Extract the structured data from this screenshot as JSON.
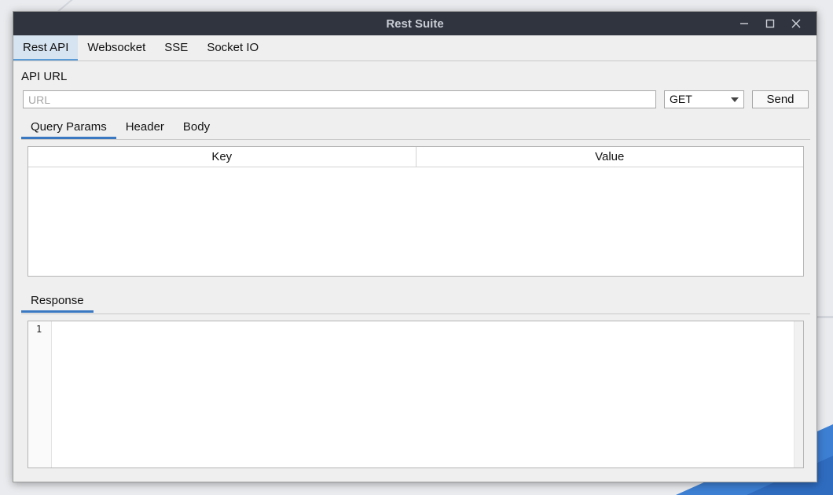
{
  "window": {
    "title": "Rest Suite"
  },
  "top_tabs": [
    {
      "label": "Rest API",
      "active": true
    },
    {
      "label": "Websocket",
      "active": false
    },
    {
      "label": "SSE",
      "active": false
    },
    {
      "label": "Socket IO",
      "active": false
    }
  ],
  "request": {
    "api_url_label": "API URL",
    "url_value": "",
    "url_placeholder": "URL",
    "method": "GET",
    "send_label": "Send"
  },
  "sub_tabs": [
    {
      "label": "Query Params",
      "active": true
    },
    {
      "label": "Header",
      "active": false
    },
    {
      "label": "Body",
      "active": false
    }
  ],
  "params_table": {
    "columns": [
      "Key",
      "Value"
    ],
    "rows": []
  },
  "response": {
    "tab_label": "Response",
    "line_numbers": [
      "1"
    ],
    "content": ""
  },
  "colors": {
    "titlebar": "#2f343f",
    "accent": "#3a78c2",
    "active_tab_bg": "#d6e3f0"
  }
}
